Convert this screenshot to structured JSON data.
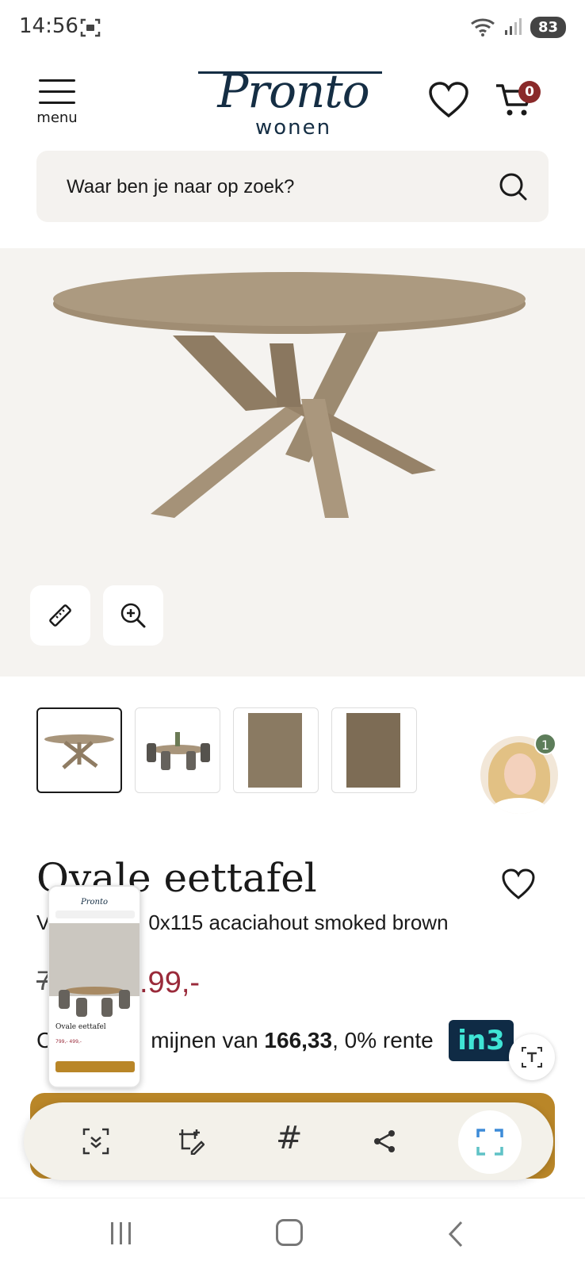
{
  "status_bar": {
    "time": "14:56",
    "battery": "83",
    "icons": [
      "screenshot-icon",
      "wifi-icon",
      "signal-icon",
      "battery-icon"
    ]
  },
  "header": {
    "menu_label": "menu",
    "logo_main": "Pronto",
    "logo_sub": "wonen",
    "cart_count": "0"
  },
  "search": {
    "placeholder": "Waar ben je naar op zoek?"
  },
  "gallery": {
    "tools": [
      "ruler-icon",
      "zoom-in-icon"
    ],
    "thumbnails": [
      "table-photo",
      "dining-set-photo",
      "wood-detail-photo",
      "wood-texture-photo"
    ],
    "chat_badge": "1"
  },
  "product": {
    "title": "Ovale eettafel",
    "subtitle_left": "V",
    "subtitle_right": "0x115 acaciahout smoked brown",
    "old_price_fragment": "7",
    "price_fragment": ".99,-",
    "installment_prefix": "C",
    "installment_mid": "mijnen van",
    "installment_amount": "166,33",
    "installment_suffix": ", 0% rente",
    "in3_label": "in3"
  },
  "preview": {
    "logo": "Pronto",
    "title": "Ovale eettafel",
    "price": "799,- 499,-"
  },
  "capture_toolbar": {
    "hash_label": "#"
  },
  "colors": {
    "brand_navy": "#152e44",
    "price_red": "#9a2a3a",
    "cta_gold": "#b98628",
    "badge_red": "#8a2a2a",
    "chat_green": "#5d7d5a"
  }
}
